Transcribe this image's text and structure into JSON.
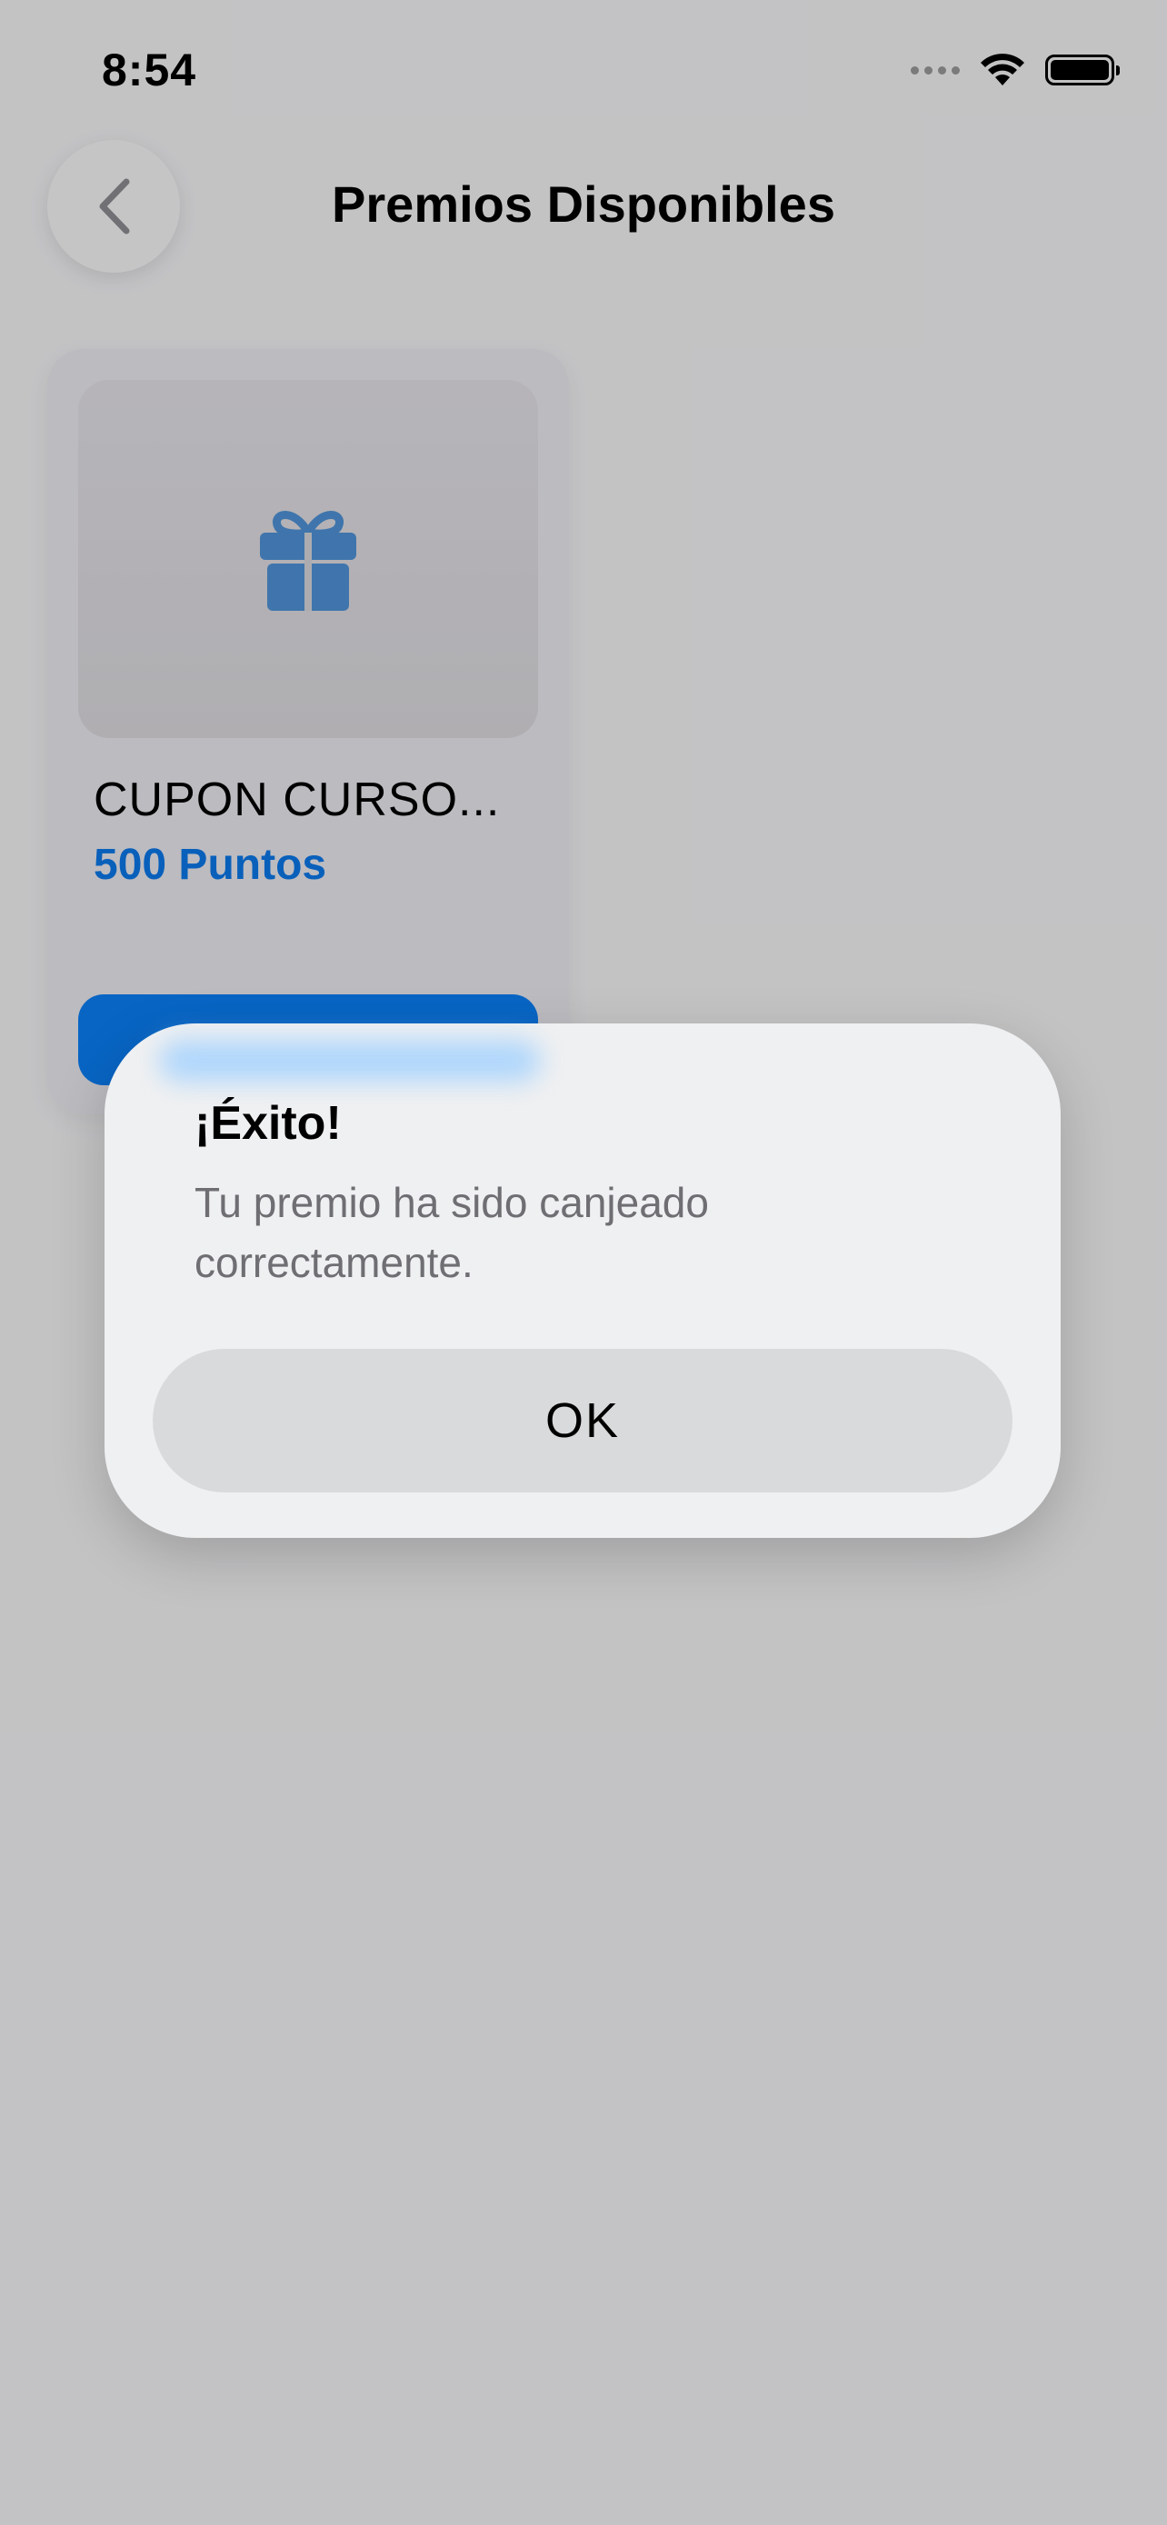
{
  "status_bar": {
    "time": "8:54",
    "icons": [
      "cellular-signal-icon",
      "wifi-icon",
      "battery-icon"
    ]
  },
  "header": {
    "back_icon": "chevron-left-icon",
    "title": "Premios Disponibles"
  },
  "rewards": [
    {
      "icon": "gift-icon",
      "title": "CUPON CURSO...",
      "points": "500 Puntos",
      "button_label": ""
    }
  ],
  "alert": {
    "title": "¡Éxito!",
    "message": "Tu premio ha sido canjeado correctamente.",
    "ok_label": "OK"
  },
  "colors": {
    "accent": "#0a7ff5",
    "points_text": "#0b79ea",
    "gift_icon": "#4f93d8",
    "overlay": "rgba(0,0,0,0.20)"
  }
}
